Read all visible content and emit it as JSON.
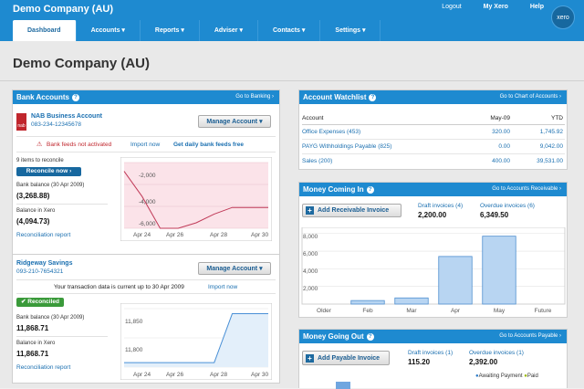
{
  "header": {
    "org": "Demo Company (AU)",
    "logout": "Logout",
    "my_xero": "My Xero",
    "help": "Help",
    "logo": "xero"
  },
  "nav": [
    {
      "label": "Dashboard"
    },
    {
      "label": "Accounts ▾"
    },
    {
      "label": "Reports ▾"
    },
    {
      "label": "Adviser ▾"
    },
    {
      "label": "Contacts ▾"
    },
    {
      "label": "Settings ▾"
    }
  ],
  "page_title": "Demo Company (AU)",
  "bank": {
    "title": "Bank Accounts",
    "link": "Go to Banking ›",
    "nab": {
      "logo": "nab",
      "name": "NAB Business Account",
      "number": "083-234-12345678",
      "manage": "Manage Account ▾",
      "feed_warning": "Bank feeds not activated",
      "import": "Import now",
      "daily": "Get daily bank feeds free",
      "items": "9 items to reconcile",
      "reconcile": "Reconcile now ›",
      "bank_bal_label": "Bank balance (30 Apr 2009)",
      "bank_bal": "(3,268.88)",
      "xero_bal_label": "Balance in Xero",
      "xero_bal": "(4,094.73)",
      "report": "Reconciliation report",
      "yticks": [
        "-2,000",
        "-4,000",
        "-6,000"
      ],
      "xticks": [
        "Apr 24",
        "Apr 26",
        "Apr 28",
        "Apr 30"
      ]
    },
    "ridge": {
      "name": "Ridgeway Savings",
      "number": "093-210-7654321",
      "manage": "Manage Account ▾",
      "current": "Your transaction data is current up to 30 Apr 2009",
      "import": "Import now",
      "reconciled": "✔ Reconciled",
      "bank_bal_label": "Bank balance (30 Apr 2009)",
      "bank_bal": "11,868.71",
      "xero_bal_label": "Balance in Xero",
      "xero_bal": "11,868.71",
      "report": "Reconciliation report",
      "yticks": [
        "11,850",
        "11,800"
      ],
      "xticks": [
        "Apr 24",
        "Apr 26",
        "Apr 28",
        "Apr 30"
      ]
    }
  },
  "watchlist": {
    "title": "Account Watchlist",
    "link": "Go to Chart of Accounts ›",
    "headers": [
      "Account",
      "May-09",
      "YTD"
    ],
    "rows": [
      [
        "Office Expenses (453)",
        "320.00",
        "1,745.92"
      ],
      [
        "PAYG Withholdings Payable (825)",
        "0.00",
        "9,042.00"
      ],
      [
        "Sales (200)",
        "400.00",
        "39,531.00"
      ]
    ]
  },
  "coming_in": {
    "title": "Money Coming In",
    "link": "Go to Accounts Receivable ›",
    "add": "Add Receivable Invoice",
    "draft_label": "Draft invoices (4)",
    "draft": "2,200.00",
    "overdue_label": "Overdue invoices (6)",
    "overdue": "6,349.50",
    "yticks": [
      "8,000",
      "6,000",
      "4,000",
      "2,000"
    ]
  },
  "going_out": {
    "title": "Money Going Out",
    "link": "Go to Accounts Payable ›",
    "add": "Add Payable Invoice",
    "draft_label": "Draft invoices (1)",
    "draft": "115.20",
    "overdue_label": "Overdue invoices (1)",
    "overdue": "2,392.00",
    "legend_awaiting": "Awaiting Payment",
    "legend_paid": "Paid"
  },
  "chart_data": [
    {
      "type": "line",
      "title": "",
      "x": [
        "Apr 23",
        "Apr 24",
        "Apr 25",
        "Apr 26",
        "Apr 27",
        "Apr 28",
        "Apr 29",
        "Apr 30",
        "May 1"
      ],
      "y": [
        -800,
        -3100,
        -6000,
        -6000,
        -5500,
        -4700,
        -4100,
        -4100,
        -4100
      ],
      "ylim": [
        -6000,
        0
      ]
    },
    {
      "type": "line",
      "title": "",
      "x": [
        "Apr 23",
        "Apr 24",
        "Apr 25",
        "Apr 26",
        "Apr 27",
        "Apr 28",
        "Apr 29",
        "Apr 30",
        "May 1"
      ],
      "y": [
        11760,
        11760,
        11760,
        11760,
        11760,
        11760,
        11868.71,
        11868.71,
        11868.71
      ],
      "ylim": [
        11750,
        11880
      ]
    },
    {
      "type": "bar",
      "title": "",
      "categories": [
        "Older",
        "Feb",
        "Mar",
        "Apr",
        "May",
        "Future"
      ],
      "values": [
        0,
        400,
        700,
        5400,
        7700,
        0
      ],
      "ylim": [
        0,
        8700
      ]
    }
  ]
}
